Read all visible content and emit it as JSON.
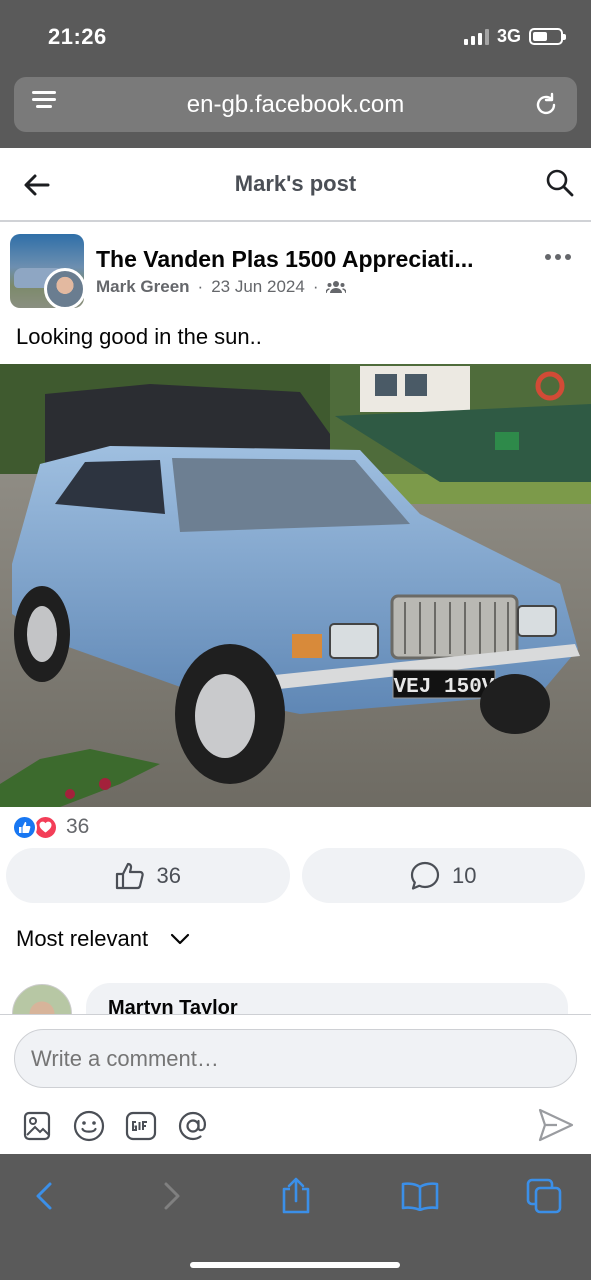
{
  "status_bar": {
    "time": "21:26",
    "network": "3G"
  },
  "browser": {
    "url": "en-gb.facebook.com"
  },
  "header": {
    "title": "Mark's post"
  },
  "post": {
    "group_name": "The Vanden Plas 1500 Appreciati...",
    "author": "Mark Green",
    "date": "23 Jun 2024",
    "separator": "·",
    "text": "Looking good in the sun..",
    "photo_plate": "VEJ 150V"
  },
  "reactions": {
    "count": "36"
  },
  "actions": {
    "like_count": "36",
    "comment_count": "10"
  },
  "comments": {
    "sort_label": "Most relevant",
    "first_commenter": "Martyn Taylor"
  },
  "composer": {
    "placeholder": "Write a comment…"
  },
  "colors": {
    "facebook_blue": "#1877f2",
    "love_red": "#f33e58",
    "chrome_gray": "#5a5a5a"
  }
}
